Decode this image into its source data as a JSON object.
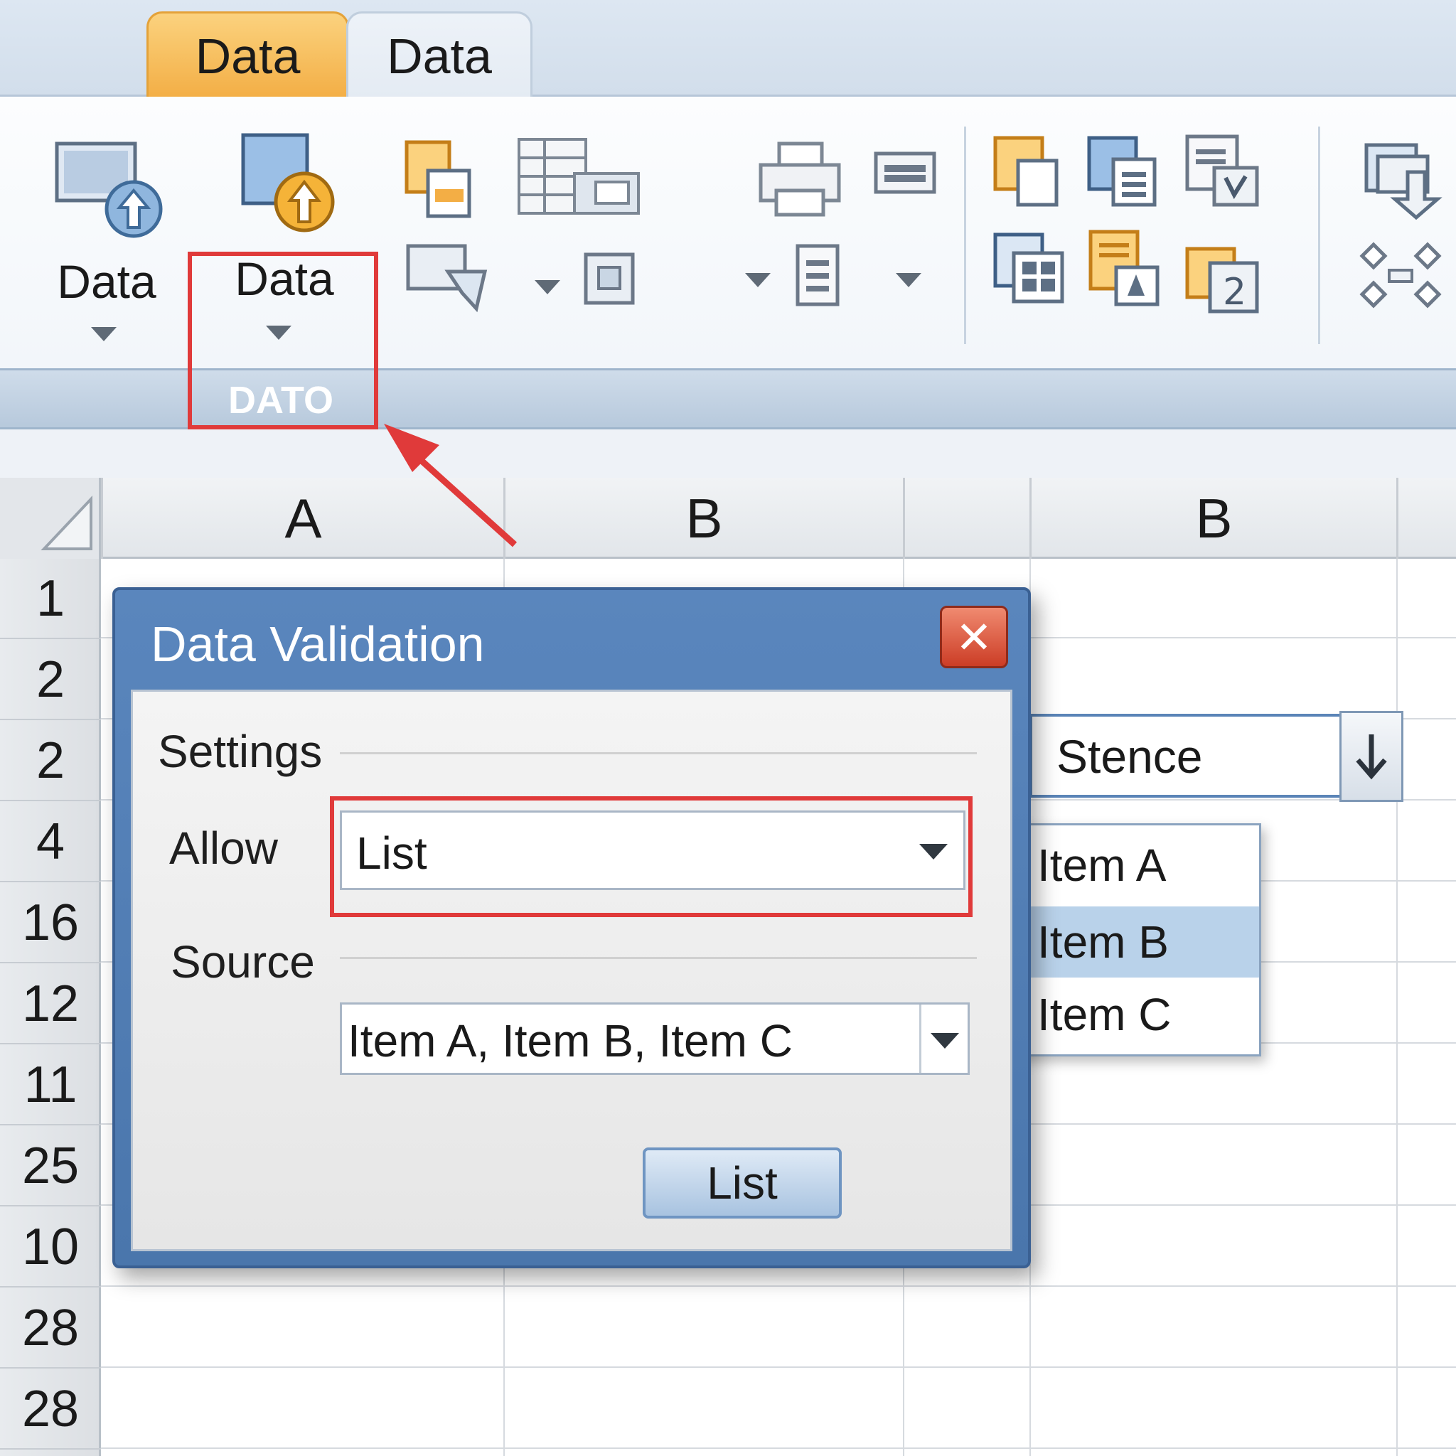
{
  "tabs": [
    {
      "label": "Data",
      "active": true
    },
    {
      "label": "Data",
      "active": false
    }
  ],
  "ribbon": {
    "buttons": [
      {
        "label": "Data",
        "icon": "import-data-icon"
      },
      {
        "label": "Data",
        "icon": "export-data-icon"
      }
    ],
    "group_label": "DATO"
  },
  "sheet": {
    "columns": [
      "A",
      "B",
      "B"
    ],
    "rows": [
      "1",
      "2",
      "2",
      "4",
      "16",
      "12",
      "11",
      "25",
      "10",
      "28",
      "28"
    ],
    "cell_dropdown": {
      "value": "Stence"
    }
  },
  "dialog": {
    "title": "Data Validation",
    "close_label": "✕",
    "section": "Settings",
    "allow_label": "Allow",
    "allow_value": "List",
    "source_label": "Source",
    "source_value": "Item A, Item B, Item C",
    "ok_label": "List"
  },
  "list_popup": {
    "items": [
      "Item A",
      "Item B",
      "Item C"
    ],
    "selected": "Item B"
  },
  "colors": {
    "accent_tab": "#f3ae45",
    "highlight_red": "#e03a3a",
    "dialog_blue": "#4a76ac",
    "selection_blue": "#b9d2ea"
  }
}
